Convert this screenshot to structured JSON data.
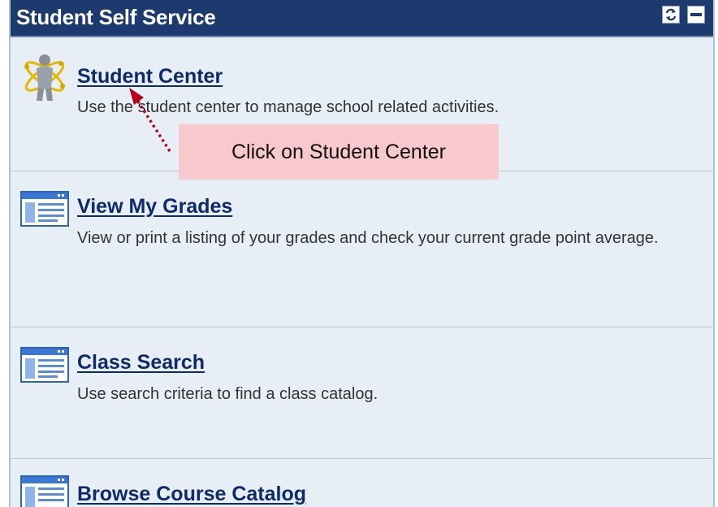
{
  "panel": {
    "title": "Student Self Service",
    "refresh_icon": "refresh-icon",
    "minimize_icon": "minimize-icon"
  },
  "items": [
    {
      "label": "Student Center",
      "description": "Use the student center to manage school related activities.",
      "icon": "student-center-icon"
    },
    {
      "label": "View My Grades",
      "description": "View or print a listing of your grades and check your current grade point average.",
      "icon": "page-icon"
    },
    {
      "label": "Class Search",
      "description": "Use search criteria to find a class catalog.",
      "icon": "page-icon"
    },
    {
      "label": "Browse Course Catalog",
      "description": "",
      "icon": "page-icon"
    }
  ],
  "callout": {
    "text": "Click on Student Center"
  },
  "colors": {
    "titlebar": "#1c3a6e",
    "panel_bg": "#e8eef6",
    "link": "#0d2a6b",
    "callout_bg": "#f7c9cd",
    "arrow": "#b3001b"
  }
}
